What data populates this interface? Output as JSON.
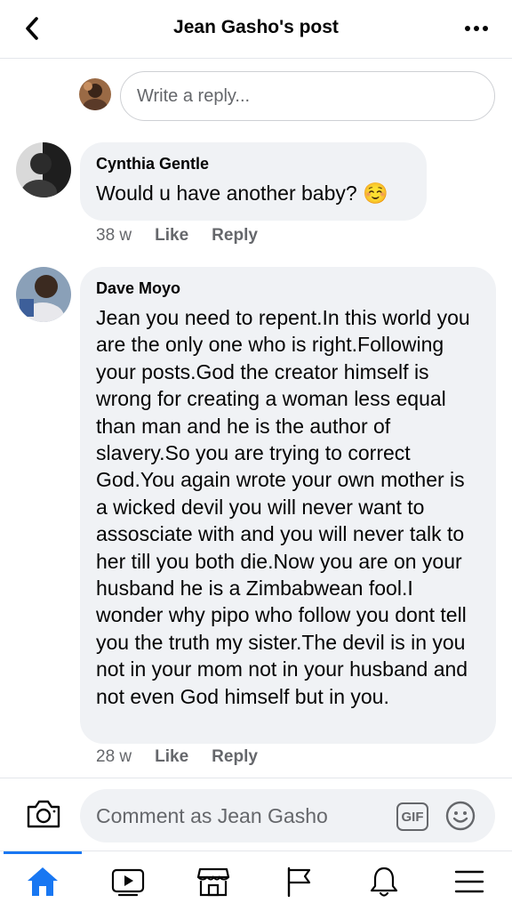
{
  "header": {
    "title": "Jean Gasho's post",
    "back_icon": "chevron-left-icon",
    "more_icon": "more-horizontal-icon"
  },
  "reply": {
    "placeholder": "Write a reply..."
  },
  "comments": [
    {
      "author": "Cynthia Gentle",
      "text": "Would u have another baby? ☺️",
      "time": "38 w",
      "like_label": "Like",
      "reply_label": "Reply"
    },
    {
      "author": "Dave Moyo",
      "text": "Jean you need to repent.In this world you are the only one who is right.Following your posts.God the creator himself is wrong for creating a woman less equal than man and he is the author of slavery.So you are trying to correct God.You again wrote your own mother is a wicked devil you will never want to assosciate with and you will never talk to her till you both die.Now you are on your husband he is a Zimbabwean fool.I wonder why pipo who follow you dont tell you the truth my sister.The devil is in you not in your mom not in your husband and not even God himself but in you.",
      "time": "28 w",
      "like_label": "Like",
      "reply_label": "Reply"
    }
  ],
  "composer": {
    "placeholder": "Comment as Jean Gasho",
    "gif_label": "GIF",
    "camera_icon": "camera-icon",
    "emoji_icon": "smiley-icon"
  },
  "tabs": [
    {
      "icon": "home-icon",
      "active": true
    },
    {
      "icon": "video-icon",
      "active": false
    },
    {
      "icon": "marketplace-icon",
      "active": false
    },
    {
      "icon": "pages-flag-icon",
      "active": false
    },
    {
      "icon": "notifications-bell-icon",
      "active": false
    },
    {
      "icon": "menu-icon",
      "active": false
    }
  ],
  "colors": {
    "accent": "#1877f2",
    "bubble": "#f0f2f5",
    "secondary_text": "#65676b"
  }
}
